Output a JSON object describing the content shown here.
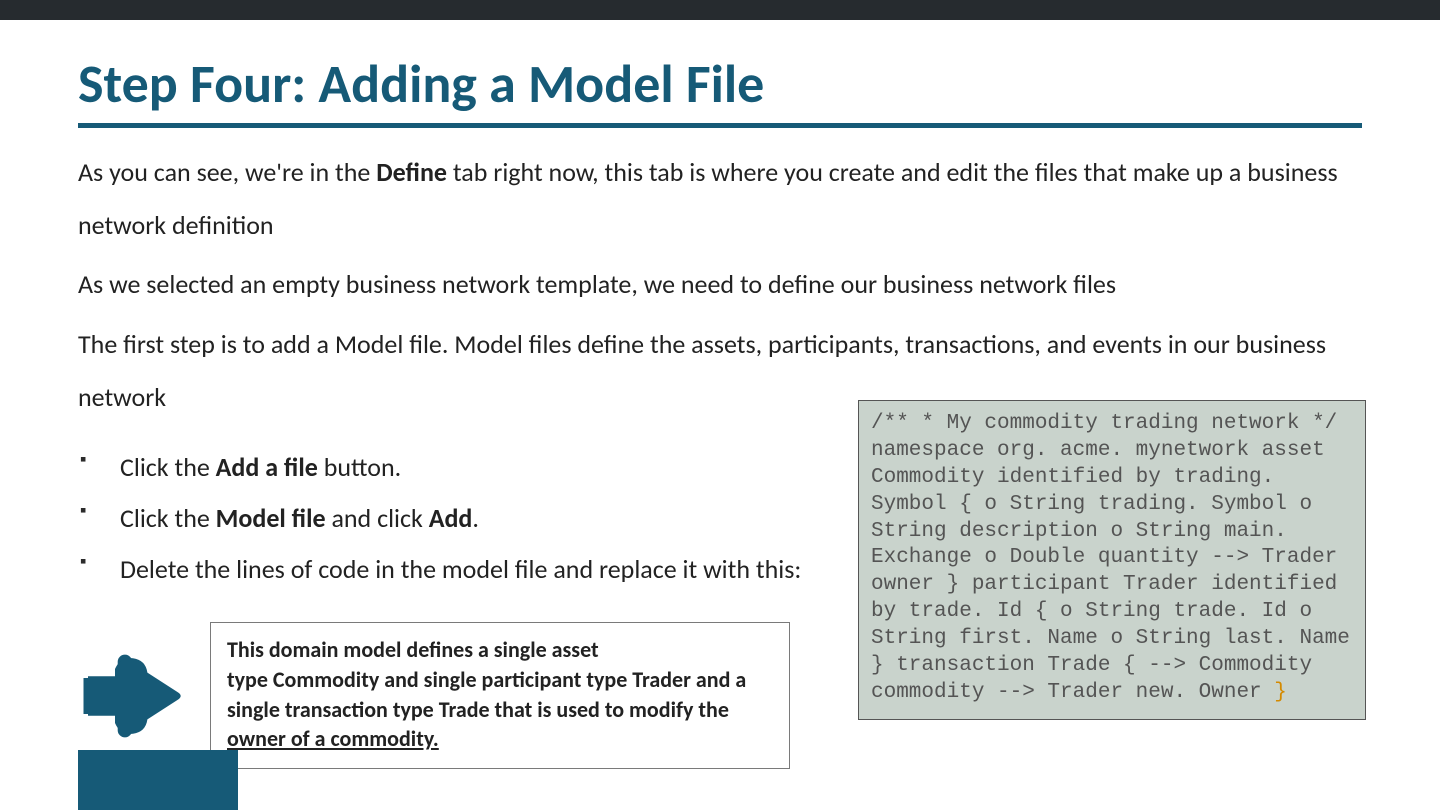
{
  "title": "Step Four: Adding a Model File",
  "para1_pre": "As you can see, we're in the ",
  "para1_bold": "Define",
  "para1_post": " tab right now, this tab is where you create and edit the files that make up a business network definition",
  "para2": "As we selected an empty business network template, we need to define our business network files",
  "para3": "The first step is to add a Model file. Model files define the assets, participants, transactions, and events in our business network",
  "bul1_pre": "Click the ",
  "bul1_bold": "Add a file",
  "bul1_post": " button.",
  "bul2_pre": "Click the ",
  "bul2_bold1": "Model file",
  "bul2_mid": " and click ",
  "bul2_bold2": "Add",
  "bul2_post": ".",
  "bul3": "Delete the lines of code in the model file and replace it with this:",
  "callout_l1": "This domain model defines a single asset",
  "callout_l2": "type Commodity and single participant type Trader and a single transaction type Trade that is used to modify the ",
  "callout_l3": "owner of a commodity.",
  "code_text": "/** * My commodity trading network */ namespace org. acme. mynetwork asset Commodity identified by trading. Symbol { o String trading. Symbol o String description o String main. Exchange o Double quantity --> Trader owner } participant Trader identified by trade. Id { o String trade. Id o String first. Name o String last. Name } transaction Trade { --> Commodity commodity --> Trader new. Owner ",
  "code_closing_brace": "}"
}
